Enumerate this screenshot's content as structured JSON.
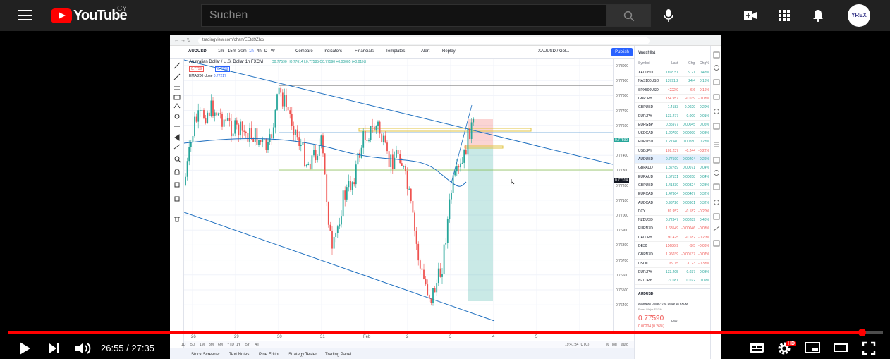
{
  "youtube": {
    "logo_text": "YouTube",
    "country_code": "CY",
    "search_placeholder": "Suchen",
    "avatar_text": "YREX"
  },
  "player": {
    "current_time": "26:55",
    "separator": " / ",
    "duration": "27:35",
    "time_display": "26:55 / 27:35",
    "progress_fraction": 0.976,
    "hd_badge": "HD"
  },
  "browser": {
    "url": "tradingview.com/chart/EEtd9Zhx/"
  },
  "tv_toolbar": {
    "symbol": "AUDUSD",
    "intervals": [
      "1m",
      "15m",
      "30m",
      "1h",
      "4h",
      "D",
      "W"
    ],
    "compare": "Compare",
    "indicators": "Indicators",
    "financials": "Financials",
    "templates": "Templates",
    "alert": "Alert",
    "replay": "Replay",
    "layout_name": "XAUUSD / Gol...",
    "publish": "Publish"
  },
  "chart": {
    "legend_title": "Australian Dollar / U.S. Dollar  1h  FXCM",
    "legend_ohlc": "O0.77590  H0.77614  L0.77585  C0.77590  +0.00005 (+0.01%)",
    "legend_bid": "0.7759",
    "legend_ask": "0.7759",
    "ema_label": "EMA 200 close",
    "ema_value": "0.77217",
    "price_labels": [
      "0.78000",
      "0.77900",
      "0.77800",
      "0.77700",
      "0.77600",
      "0.77500",
      "0.77400",
      "0.77300",
      "0.77200",
      "0.77100",
      "0.77000",
      "0.76900",
      "0.76800",
      "0.76700",
      "0.76600",
      "0.76500",
      "0.76400"
    ],
    "current_price_label": "0.77590",
    "cursor_price_label": "0.77314",
    "time_labels": [
      "26",
      "29",
      "30",
      "31",
      "Feb",
      "2",
      "3",
      "4",
      "5"
    ],
    "time_readout": "19:41:34 (UTC)",
    "scale_options": [
      "%",
      "log",
      "auto"
    ]
  },
  "bottom_tabs": [
    "Stock Screener",
    "Text Notes",
    "Pine Editor",
    "Strategy Tester",
    "Trading Panel"
  ],
  "date_ranges": [
    "1D",
    "5D",
    "1M",
    "3M",
    "6M",
    "YTD",
    "1Y",
    "5Y",
    "All"
  ],
  "watchlist": {
    "title": "Watchlist",
    "columns": [
      "Symbol",
      "Last",
      "Chg",
      "Chg%"
    ],
    "rows": [
      {
        "sym": "XAUUSD",
        "last": "1898.51",
        "chg": "9.21",
        "pct": "0.48%",
        "up": true
      },
      {
        "sym": "NAS100USD",
        "last": "13791.2",
        "chg": "24.4",
        "pct": "0.18%",
        "up": true
      },
      {
        "sym": "SPX500USD",
        "last": "4222.9",
        "chg": "-6.6",
        "pct": "-0.16%",
        "up": false
      },
      {
        "sym": "GBPJPY",
        "last": "154.957",
        "chg": "-0.039",
        "pct": "-0.03%",
        "up": false
      },
      {
        "sym": "GBPUSD",
        "last": "1.4183",
        "chg": "0.0029",
        "pct": "0.20%",
        "up": true
      },
      {
        "sym": "EURJPY",
        "last": "133.277",
        "chg": "0.009",
        "pct": "0.01%",
        "up": true
      },
      {
        "sym": "EURGBP",
        "last": "0.85977",
        "chg": "0.00045",
        "pct": "0.05%",
        "up": true
      },
      {
        "sym": "USDCAD",
        "last": "1.20799",
        "chg": "0.00099",
        "pct": "0.08%",
        "up": true
      },
      {
        "sym": "EURUSD",
        "last": "1.21940",
        "chg": "0.00280",
        "pct": "0.23%",
        "up": true
      },
      {
        "sym": "USDJPY",
        "last": "109.237",
        "chg": "-0.244",
        "pct": "-0.22%",
        "up": false
      },
      {
        "sym": "AUDUSD",
        "last": "0.77590",
        "chg": "0.00204",
        "pct": "0.26%",
        "up": true
      },
      {
        "sym": "GBPAUD",
        "last": "1.82789",
        "chg": "0.00071",
        "pct": "0.04%",
        "up": true
      },
      {
        "sym": "EURAUD",
        "last": "1.57151",
        "chg": "0.00058",
        "pct": "0.04%",
        "up": true
      },
      {
        "sym": "GBPUSD",
        "last": "1.41839",
        "chg": "0.00324",
        "pct": "0.23%",
        "up": true
      },
      {
        "sym": "EURCAD",
        "last": "1.47304",
        "chg": "0.00467",
        "pct": "0.32%",
        "up": true
      },
      {
        "sym": "AUDCAD",
        "last": "0.93726",
        "chg": "0.00301",
        "pct": "0.32%",
        "up": true
      },
      {
        "sym": "DXY",
        "last": "89.952",
        "chg": "-0.182",
        "pct": "-0.20%",
        "up": false
      },
      {
        "sym": "NZDUSD",
        "last": "0.72347",
        "chg": "0.00289",
        "pct": "0.40%",
        "up": true
      },
      {
        "sym": "EURNZD",
        "last": "1.68549",
        "chg": "-0.00046",
        "pct": "-0.03%",
        "up": false
      },
      {
        "sym": "CADJPY",
        "last": "90.425",
        "chg": "-0.182",
        "pct": "-0.20%",
        "up": false
      },
      {
        "sym": "DE30",
        "last": "15686.9",
        "chg": "-9.5",
        "pct": "-0.06%",
        "up": false
      },
      {
        "sym": "GBPNZD",
        "last": "1.96039",
        "chg": "-0.00137",
        "pct": "-0.07%",
        "up": false
      },
      {
        "sym": "USOIL",
        "last": "69.15",
        "chg": "-0.23",
        "pct": "-0.33%",
        "up": false
      },
      {
        "sym": "EURJPY",
        "last": "133.205",
        "chg": "0.037",
        "pct": "0.03%",
        "up": true
      },
      {
        "sym": "NZDJPY",
        "last": "79.081",
        "chg": "0.072",
        "pct": "0.09%",
        "up": true
      }
    ],
    "detail_symbol": "AUDUSD",
    "detail_name": "Australian Dollar / U.S. Dollar  1h  FXCM",
    "detail_sub": "Forex  Major  FXCM",
    "detail_price": "0.77590",
    "detail_currency": "USD",
    "detail_change": "0.00204 (0.26%)"
  },
  "colors": {
    "youtube_red": "#ff0000",
    "tv_blue": "#2962ff",
    "candle_up": "#26a69a",
    "candle_down": "#ef5350"
  }
}
